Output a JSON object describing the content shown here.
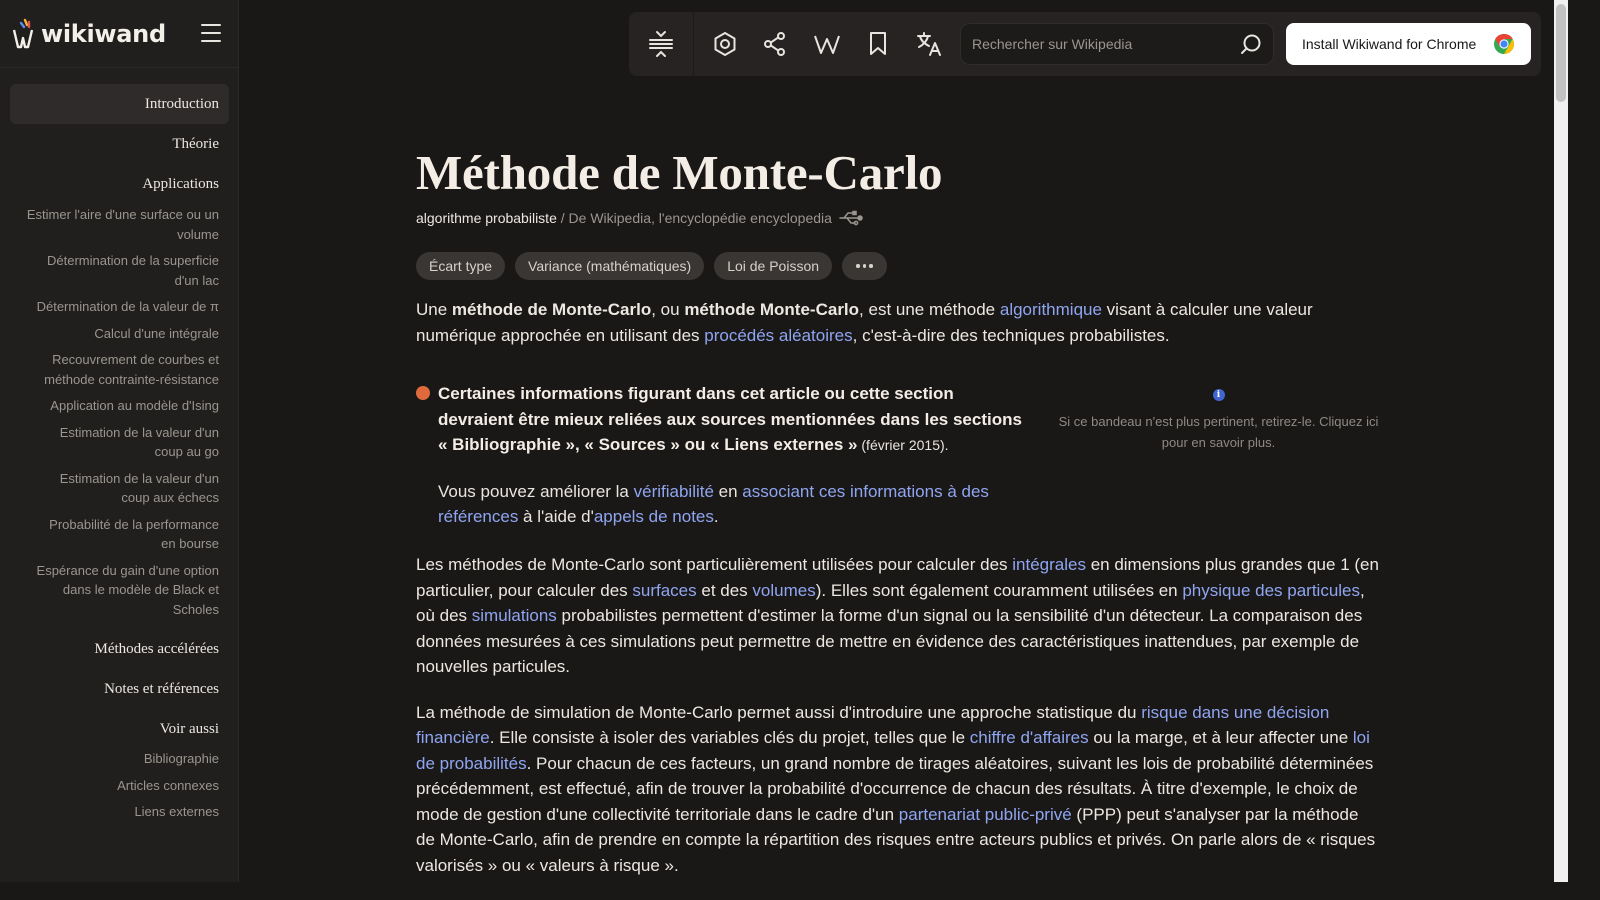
{
  "app": {
    "logo_text": "wikiwand"
  },
  "sidebar": {
    "toc": [
      {
        "label": "Introduction",
        "level": 1,
        "active": true
      },
      {
        "label": "Théorie",
        "level": 1
      },
      {
        "label": "Applications",
        "level": 1
      },
      {
        "label": "Estimer l'aire d'une surface ou un volume",
        "level": 2
      },
      {
        "label": "Détermination de la superficie d'un lac",
        "level": 2
      },
      {
        "label": "Détermination de la valeur de π",
        "level": 2
      },
      {
        "label": "Calcul d'une intégrale",
        "level": 2
      },
      {
        "label": "Recouvrement de courbes et méthode contrainte-résistance",
        "level": 2
      },
      {
        "label": "Application au modèle d'Ising",
        "level": 2
      },
      {
        "label": "Estimation de la valeur d'un coup au go",
        "level": 2
      },
      {
        "label": "Estimation de la valeur d'un coup aux échecs",
        "level": 2
      },
      {
        "label": "Probabilité de la performance en bourse",
        "level": 2
      },
      {
        "label": "Espérance du gain d'une option dans le modèle de Black et Scholes",
        "level": 2
      },
      {
        "label": "Méthodes accélérées",
        "level": 1
      },
      {
        "label": "Notes et références",
        "level": 1
      },
      {
        "label": "Voir aussi",
        "level": 1
      },
      {
        "label": "Bibliographie",
        "level": 2
      },
      {
        "label": "Articles connexes",
        "level": 2
      },
      {
        "label": "Liens externes",
        "level": 2
      }
    ]
  },
  "toolbar": {
    "icons": [
      "toc-collapse-icon",
      "settings-icon",
      "share-icon",
      "wikipedia-icon",
      "bookmark-icon",
      "translate-icon"
    ],
    "search_placeholder": "Rechercher sur Wikipedia",
    "install_label": "Install Wikiwand for Chrome"
  },
  "article": {
    "title": "Méthode de Monte-Carlo",
    "subtitle_main": "algorithme probabiliste",
    "subtitle_sep": " / ",
    "subtitle_source": "De Wikipedia, l'encyclopédie encyclopedia",
    "tags": [
      "Écart type",
      "Variance (mathématiques)",
      "Loi de Poisson"
    ],
    "intro": {
      "t1": "Une ",
      "b1": "méthode de Monte-Carlo",
      "t2": ", ou ",
      "b2": "méthode Monte-Carlo",
      "t3": ", est une méthode ",
      "l1": "algorithmique",
      "t4": " visant à calculer une valeur numérique approchée en utilisant des ",
      "l2": "procédés aléatoires",
      "t5": ", c'est-à-dire des techniques probabilistes."
    },
    "banner": {
      "bold": "Certaines informations figurant dans cet article ou cette section devraient être mieux reliées aux sources mentionnées dans les sections « Bibliographie », « Sources » ou « Liens externes »",
      "date": " (février 2015).",
      "p2_t1": "Vous pouvez améliorer la ",
      "p2_l1": "vérifiabilité",
      "p2_t2": " en ",
      "p2_l2": "associant ces informations à des références",
      "p2_t3": " à l'aide d'",
      "p2_l3": "appels de notes",
      "p2_t4": ".",
      "side_text": "Si ce bandeau n'est plus pertinent, retirez-le. Cliquez ici pour en savoir plus.",
      "info_glyph": "i"
    },
    "p3": {
      "t1": "Les méthodes de Monte-Carlo sont particulièrement utilisées pour calculer des ",
      "l1": "intégrales",
      "t2": " en dimensions plus grandes que 1 (en particulier, pour calculer des ",
      "l2": "surfaces",
      "t3": " et des ",
      "l3": "volumes",
      "t4": "). Elles sont également couramment utilisées en ",
      "l4": "physique des particules",
      "t5": ", où des ",
      "l5": "simulations",
      "t6": " probabilistes permettent d'estimer la forme d'un signal ou la sensibilité d'un détecteur. La comparaison des données mesurées à ces simulations peut permettre de mettre en évidence des caractéristiques inattendues, par exemple de nouvelles particules."
    },
    "p4": {
      "t1": "La méthode de simulation de Monte-Carlo permet aussi d'introduire une approche statistique du ",
      "l1": "risque dans une décision financière",
      "t2": ". Elle consiste à isoler des variables clés du projet, telles que le ",
      "l2": "chiffre d'affaires",
      "t3": " ou la marge, et à leur affecter une ",
      "l3": "loi de probabilités",
      "t4": ". Pour chacun de ces facteurs, un grand nombre de tirages aléatoires, suivant les lois de probabilité déterminées précédemment, est effectué, afin de trouver la probabilité d'occurrence de chacun des résultats. À titre d'exemple, le choix de mode de gestion d'une collectivité territoriale dans le cadre d'un ",
      "l4": "partenariat public-privé",
      "t5": " (PPP) peut s'analyser par la méthode de Monte-Carlo, afin de prendre en compte la répartition des risques entre acteurs publics et privés. On parle alors de « risques valorisés » ou « valeurs à risque »."
    }
  }
}
